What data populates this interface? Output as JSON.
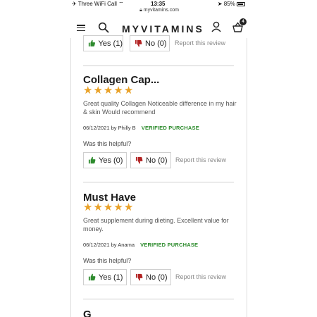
{
  "status": {
    "carrier": "Three WiFi Call",
    "time": "13:35",
    "battery_text": "85%",
    "battery_level": 0.85
  },
  "browser": {
    "url": "myvitamins.com"
  },
  "header": {
    "logo": "MYVITAMINS",
    "basket_count": "4"
  },
  "vote_labels": {
    "yes": "Yes",
    "no": "No"
  },
  "top_partial": {
    "yes_count": "(1)",
    "no_count": "(0)",
    "report": "Report this review"
  },
  "reviews": [
    {
      "title": "Collagen Cap...",
      "rating": 5,
      "body": "Great quality Collagen Noticeable difference in my hair & skin Would recommend",
      "date": "06/12/2021",
      "by": "by",
      "author": "Philly B",
      "verified": "VERIFIED PURCHASE",
      "helpful_q": "Was this helpful?",
      "yes_count": "(0)",
      "no_count": "(0)",
      "report": "Report this review"
    },
    {
      "title": "Must Have",
      "rating": 5,
      "body": "Great supplement during dieting. Excellent value for money.",
      "date": "06/12/2021",
      "by": "by",
      "author": "Anama",
      "verified": "VERIFIED PURCHASE",
      "helpful_q": "Was this helpful?",
      "yes_count": "(1)",
      "no_count": "(0)",
      "report": "Report this review"
    }
  ],
  "next_review_initial": "G",
  "colors": {
    "star": "#e9a127",
    "thumb_up": "#2e8b2e",
    "thumb_down": "#b22222",
    "verified": "#2a8a2a"
  }
}
